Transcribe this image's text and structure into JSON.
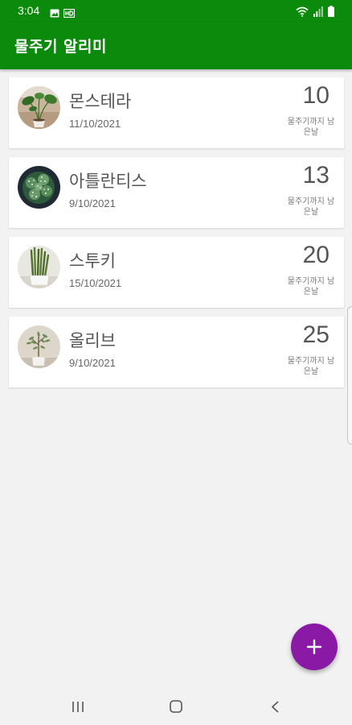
{
  "status_bar": {
    "time": "3:04",
    "left_icons": [
      "image-icon",
      "hd-icon"
    ],
    "right_icons": [
      "wifi-icon",
      "signal-icon",
      "battery-icon"
    ]
  },
  "app_bar": {
    "title": "물주기 알리미",
    "background_color": "#0b8a0b"
  },
  "plants": [
    {
      "name": "몬스테라",
      "date": "11/10/2021",
      "days_left": "10",
      "days_label": "물주기까지 남은날",
      "photo": "monstera-photo"
    },
    {
      "name": "아틀란티스",
      "date": "9/10/2021",
      "days_left": "13",
      "days_label": "물주기까지 남은날",
      "photo": "atlantis-photo"
    },
    {
      "name": "스투키",
      "date": "15/10/2021",
      "days_left": "20",
      "days_label": "물주기까지 남은날",
      "photo": "stuckyi-photo"
    },
    {
      "name": "올리브",
      "date": "9/10/2021",
      "days_left": "25",
      "days_label": "물주기까지 남은날",
      "photo": "olive-photo"
    }
  ],
  "fab": {
    "icon": "plus-icon",
    "color": "#8a1aa6"
  },
  "nav_bar": {
    "buttons": [
      "recent-apps-icon",
      "home-icon",
      "back-icon"
    ]
  }
}
